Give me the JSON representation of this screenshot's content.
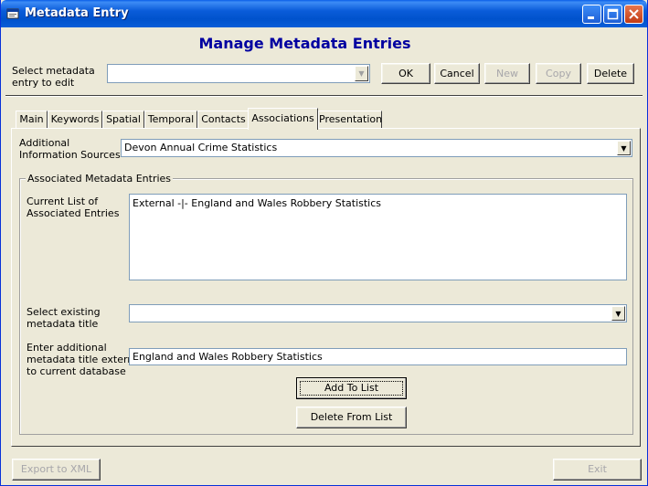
{
  "window": {
    "title": "Metadata Entry",
    "minimize": "_",
    "maximize": "□",
    "close": "✕"
  },
  "heading": "Manage Metadata Entries",
  "select_entry": {
    "label_line1": "Select metadata",
    "label_line2": "entry to edit",
    "value": ""
  },
  "toolbar": {
    "ok": "OK",
    "cancel": "Cancel",
    "new": "New",
    "copy": "Copy",
    "delete": "Delete"
  },
  "tabs": [
    {
      "label": "Main"
    },
    {
      "label": "Keywords"
    },
    {
      "label": "Spatial"
    },
    {
      "label": "Temporal"
    },
    {
      "label": "Contacts"
    },
    {
      "label": "Associations"
    },
    {
      "label": "Presentation"
    }
  ],
  "active_tab": "Associations",
  "info_sources": {
    "label_line1": "Additional",
    "label_line2": "Information Sources",
    "value": "Devon Annual Crime Statistics"
  },
  "group": {
    "title": "Associated Metadata Entries",
    "current_list_label_line1": "Current List of",
    "current_list_label_line2": "Associated Entries",
    "current_list_items": [
      "External -|- England and Wales Robbery Statistics"
    ],
    "select_title_label_line1": "Select existing",
    "select_title_label_line2": "metadata title",
    "select_title_value": "",
    "external_label_line1": "Enter additional",
    "external_label_line2": "metadata title external",
    "external_label_line3": "to current database",
    "external_value": "England and Wales Robbery Statistics",
    "add_button": "Add To List",
    "delete_button": "Delete From List"
  },
  "footer": {
    "export": "Export to XML",
    "exit": "Exit"
  },
  "colors": {
    "titlebar": "#0A5CD9",
    "heading": "#0000A0",
    "face": "#ECE9D8"
  }
}
